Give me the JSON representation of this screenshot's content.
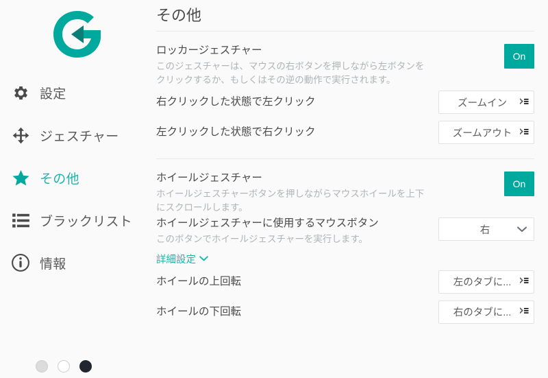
{
  "brand": {
    "logo_icon": "gesture-g-logo-icon",
    "accent_color": "#00a99d",
    "accent_text_color": "#1bb7ab"
  },
  "sidebar": {
    "items": [
      {
        "label": "設定",
        "icon": "gear-icon",
        "active": false
      },
      {
        "label": "ジェスチャー",
        "icon": "move-arrows-icon",
        "active": false
      },
      {
        "label": "その他",
        "icon": "star-icon",
        "active": true
      },
      {
        "label": "ブラックリスト",
        "icon": "list-icon",
        "active": false
      },
      {
        "label": "情報",
        "icon": "info-circle-icon",
        "active": false
      }
    ],
    "theme_dots": [
      {
        "name": "theme-dot-gray",
        "color": "#dcdcdc"
      },
      {
        "name": "theme-dot-white",
        "color": "#ffffff"
      },
      {
        "name": "theme-dot-dark",
        "color": "#22262e"
      }
    ]
  },
  "main": {
    "title": "その他",
    "rocker": {
      "title": "ロッカージェスチャー",
      "desc": "このジェスチャーは、マウスの右ボタンを押しながら左ボタンをクリックするか、もしくはその逆の動作で実行されます。",
      "toggle_label": "On",
      "rows": [
        {
          "label": "右クリックした状態で左クリック",
          "value": "ズームイン",
          "icon": "action-list-icon"
        },
        {
          "label": "左クリックした状態で右クリック",
          "value": "ズームアウト",
          "icon": "action-list-icon"
        }
      ]
    },
    "wheel": {
      "title": "ホイールジェスチャー",
      "desc": "ホイールジェスチャーボタンを押しながらマウスホイールを上下にスクロールします。",
      "toggle_label": "On",
      "button_row": {
        "title": "ホイールジェスチャーに使用するマウスボタン",
        "desc": "このボタンでホイールジェスチャーを実行します。",
        "value": "右",
        "icon": "chevron-down-icon"
      },
      "advanced_label": "詳細設定",
      "advanced_icon": "chevron-down-icon",
      "rows": [
        {
          "label": "ホイールの上回転",
          "value": "左のタブに...",
          "icon": "action-list-icon"
        },
        {
          "label": "ホイールの下回転",
          "value": "右のタブに...",
          "icon": "action-list-icon"
        }
      ]
    }
  }
}
